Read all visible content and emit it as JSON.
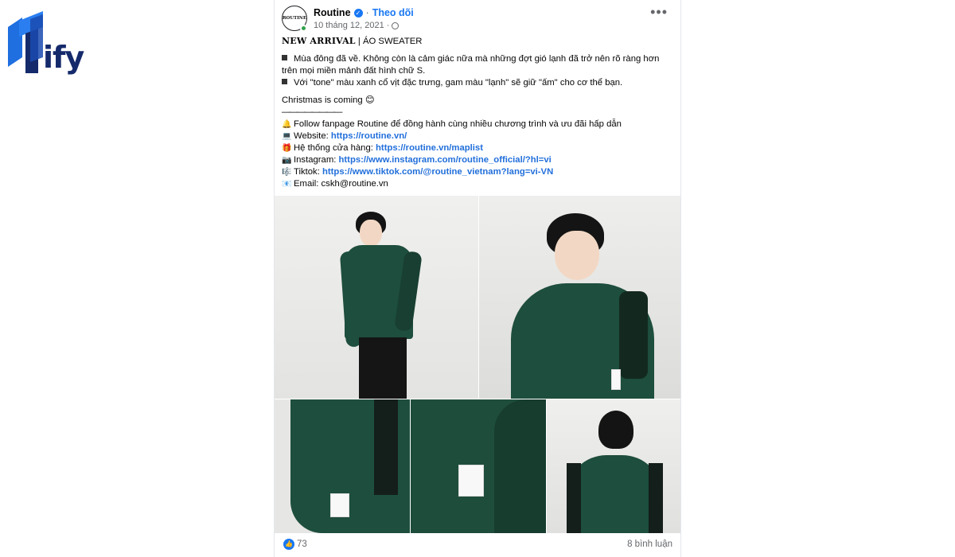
{
  "brand": {
    "logo_text": "ify"
  },
  "post": {
    "page_name": "Routine",
    "follow_label": "Theo dõi",
    "separator": "·",
    "date": "10 tháng 12, 2021",
    "more_label": "•••",
    "avatar_text": "ROUTINE",
    "title_bold": "NEW ARRIVAL",
    "title_rest": " | ÁO SWEATER",
    "bullet1_line1": "Mùa đông đã về. Không còn là cảm giác nữa mà những đợt gió lạnh đã trở nên rõ ràng hơn",
    "bullet1_line2": "trên mọi miền mảnh đất hình chữ S.",
    "bullet2": "Với \"tone\" màu xanh cổ vịt đặc trưng, gam màu \"lạnh\" sẽ giữ \"ấm\" cho cơ thể bạn.",
    "christmas": "Christmas is coming 😊",
    "divider": "————————",
    "follow_line": "Follow fanpage Routine để đồng hành cùng nhiều chương trình và ưu đãi hấp dẫn",
    "website_label": "Website: ",
    "website_url": "https://routine.vn/",
    "stores_label": "Hệ thống cửa hàng: ",
    "stores_url": "https://routine.vn/maplist",
    "instagram_label": "Instagram: ",
    "instagram_url": "https://www.instagram.com/routine_official/?hl=vi",
    "tiktok_label": "Tiktok: ",
    "tiktok_url": "https://www.tiktok.com/@routine_vietnam?lang=vi-VN",
    "email_label": "Email: ",
    "email": "cskh@routine.vn",
    "icons": {
      "bell": "🔔",
      "website": "💻",
      "stores": "🎁",
      "instagram": "📷",
      "tiktok": "🎼",
      "email": "📧"
    },
    "reactions_count": "73",
    "comments_label": "8 bình luận"
  },
  "colors": {
    "accent": "#1877f2",
    "link": "#216fdb",
    "sweater": "#1e4e3d",
    "brand_navy": "#152a6b",
    "brand_blue": "#1f6fe0"
  }
}
